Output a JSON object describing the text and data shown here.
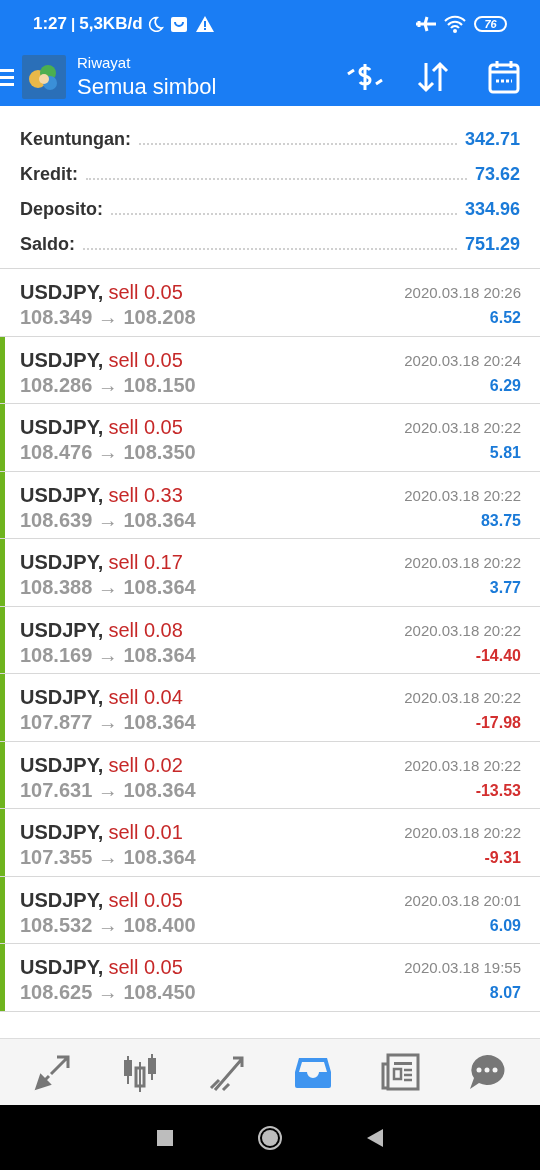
{
  "status_bar": {
    "time": "1:27",
    "separator": "|",
    "speed": "5,3KB/d",
    "battery": "76"
  },
  "toolbar": {
    "subtitle": "Riwayat",
    "title": "Semua simbol"
  },
  "summary": [
    {
      "label": "Keuntungan:",
      "value": "342.71"
    },
    {
      "label": "Kredit:",
      "value": "73.62"
    },
    {
      "label": "Deposito:",
      "value": "334.96"
    },
    {
      "label": "Saldo:",
      "value": "751.29"
    }
  ],
  "deals": [
    {
      "symbol": "USDJPY,",
      "order": "sell 0.05",
      "kind": "sell",
      "prices": "108.349 → 108.208",
      "time": "2020.03.18 20:26",
      "profit": "6.52",
      "loss": false,
      "flagged": false
    },
    {
      "symbol": "USDJPY,",
      "order": "sell 0.05",
      "kind": "sell",
      "prices": "108.286 → 108.150",
      "time": "2020.03.18 20:24",
      "profit": "6.29",
      "loss": false,
      "flagged": true
    },
    {
      "symbol": "USDJPY,",
      "order": "sell 0.05",
      "kind": "sell",
      "prices": "108.476 → 108.350",
      "time": "2020.03.18 20:22",
      "profit": "5.81",
      "loss": false,
      "flagged": true
    },
    {
      "symbol": "USDJPY,",
      "order": "sell 0.33",
      "kind": "sell",
      "prices": "108.639 → 108.364",
      "time": "2020.03.18 20:22",
      "profit": "83.75",
      "loss": false,
      "flagged": true
    },
    {
      "symbol": "USDJPY,",
      "order": "sell 0.17",
      "kind": "sell",
      "prices": "108.388 → 108.364",
      "time": "2020.03.18 20:22",
      "profit": "3.77",
      "loss": false,
      "flagged": true
    },
    {
      "symbol": "USDJPY,",
      "order": "sell 0.08",
      "kind": "sell",
      "prices": "108.169 → 108.364",
      "time": "2020.03.18 20:22",
      "profit": "-14.40",
      "loss": true,
      "flagged": true
    },
    {
      "symbol": "USDJPY,",
      "order": "sell 0.04",
      "kind": "sell",
      "prices": "107.877 → 108.364",
      "time": "2020.03.18 20:22",
      "profit": "-17.98",
      "loss": true,
      "flagged": true
    },
    {
      "symbol": "USDJPY,",
      "order": "sell 0.02",
      "kind": "sell",
      "prices": "107.631 → 108.364",
      "time": "2020.03.18 20:22",
      "profit": "-13.53",
      "loss": true,
      "flagged": true
    },
    {
      "symbol": "USDJPY,",
      "order": "sell 0.01",
      "kind": "sell",
      "prices": "107.355 → 108.364",
      "time": "2020.03.18 20:22",
      "profit": "-9.31",
      "loss": true,
      "flagged": true
    },
    {
      "symbol": "USDJPY,",
      "order": "sell 0.05",
      "kind": "sell",
      "prices": "108.532 → 108.400",
      "time": "2020.03.18 20:01",
      "profit": "6.09",
      "loss": false,
      "flagged": true
    },
    {
      "symbol": "USDJPY,",
      "order": "sell 0.05",
      "kind": "sell",
      "prices": "108.625 → 108.450",
      "time": "2020.03.18 19:55",
      "profit": "8.07",
      "loss": false,
      "flagged": true
    }
  ],
  "bottom_nav": [
    {
      "selected": false
    },
    {
      "selected": false
    },
    {
      "selected": false
    },
    {
      "selected": true
    },
    {
      "selected": false
    },
    {
      "selected": false
    }
  ]
}
